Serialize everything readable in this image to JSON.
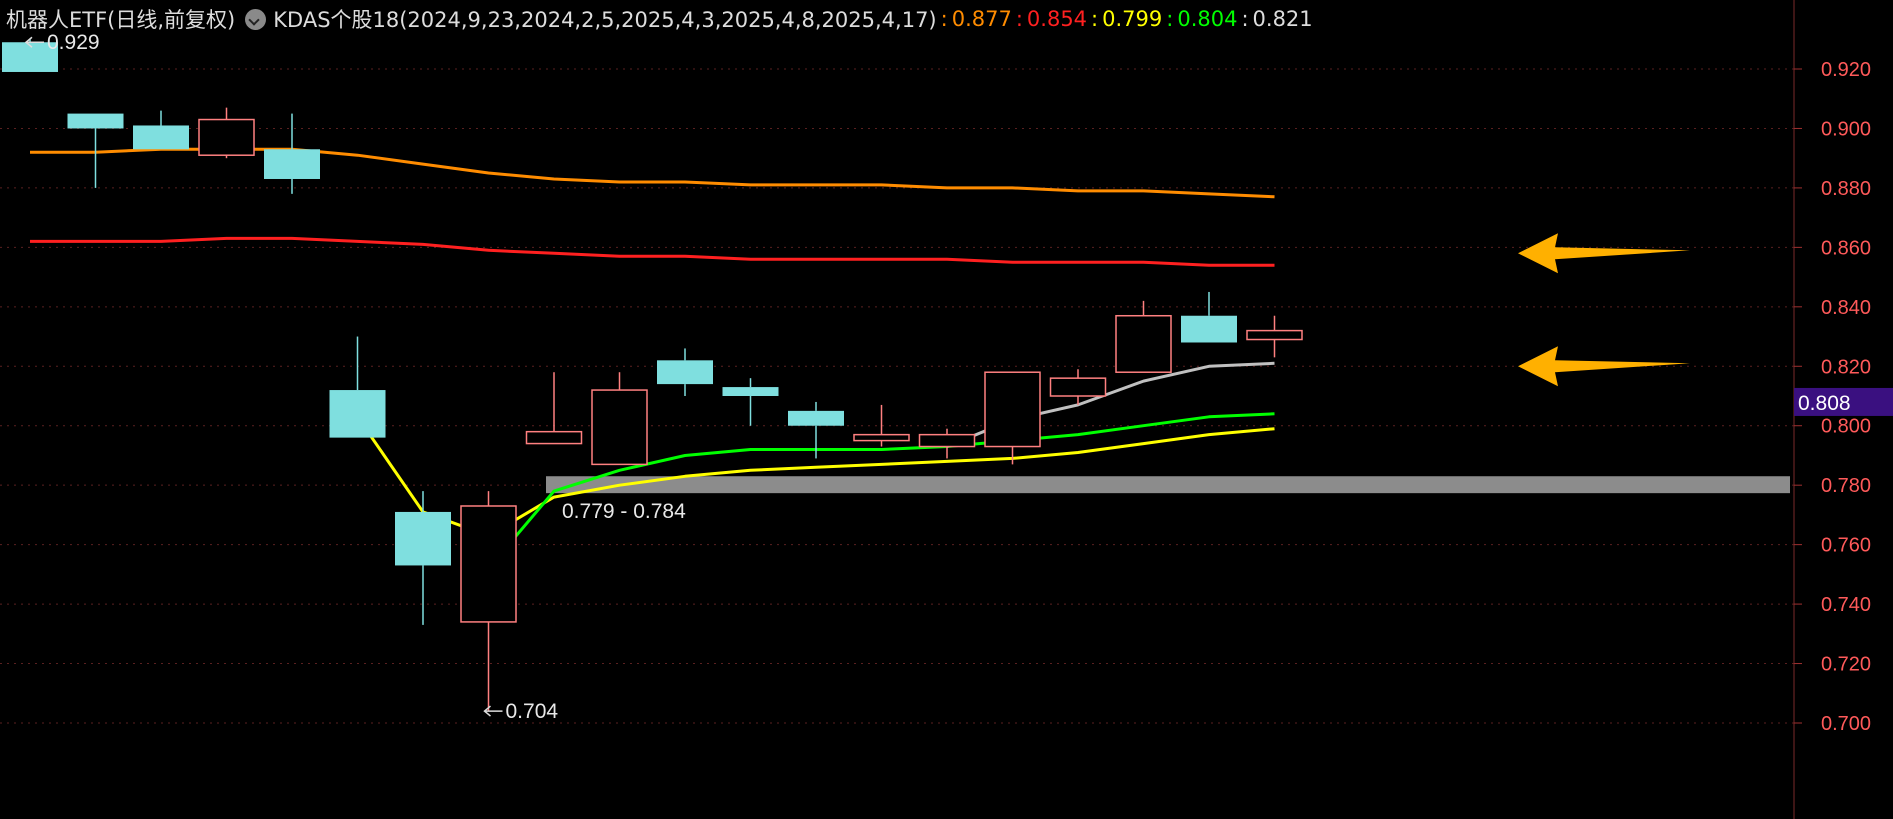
{
  "header": {
    "instrument": "机器人ETF(日线,前复权)",
    "indicator": "KDAS个股18(2024,9,23,2024,2,5,2025,4,3,2025,4,8,2025,4,17)",
    "values": [
      {
        "text": "0.877",
        "color": "#ff8c00"
      },
      {
        "text": "0.854",
        "color": "#ff2020"
      },
      {
        "text": "0.799",
        "color": "#ffff00"
      },
      {
        "text": "0.804",
        "color": "#00ff00"
      },
      {
        "text": "0.821",
        "color": "#dddddd"
      }
    ]
  },
  "colors": {
    "background": "#000000",
    "up_candle": "#ff8080",
    "down_candle": "#7fdfdf",
    "grid": "#5a2020",
    "axis_text": "#ff5a5a",
    "price_tag_bg": "#3a1080",
    "support_bar": "#8c8c8c",
    "arrow": "#ffb000"
  },
  "chart_data": {
    "type": "candlestick",
    "ylim": [
      0.695,
      0.935
    ],
    "y_ticks": [
      "0.920",
      "0.900",
      "0.880",
      "0.860",
      "0.840",
      "0.820",
      "0.800",
      "0.780",
      "0.760",
      "0.740",
      "0.720",
      "0.700"
    ],
    "candles": [
      {
        "open": 0.929,
        "high": 0.93,
        "low": 0.919,
        "close": 0.919
      },
      {
        "open": 0.905,
        "high": 0.905,
        "low": 0.88,
        "close": 0.9
      },
      {
        "open": 0.901,
        "high": 0.906,
        "low": 0.893,
        "close": 0.893
      },
      {
        "open": 0.891,
        "high": 0.907,
        "low": 0.89,
        "close": 0.903
      },
      {
        "open": 0.893,
        "high": 0.905,
        "low": 0.878,
        "close": 0.883
      },
      {
        "open": 0.812,
        "high": 0.83,
        "low": 0.796,
        "close": 0.796
      },
      {
        "open": 0.771,
        "high": 0.778,
        "low": 0.733,
        "close": 0.753
      },
      {
        "open": 0.734,
        "high": 0.778,
        "low": 0.704,
        "close": 0.773
      },
      {
        "open": 0.794,
        "high": 0.818,
        "low": 0.794,
        "close": 0.798
      },
      {
        "open": 0.787,
        "high": 0.818,
        "low": 0.787,
        "close": 0.812
      },
      {
        "open": 0.822,
        "high": 0.826,
        "low": 0.81,
        "close": 0.814
      },
      {
        "open": 0.813,
        "high": 0.816,
        "low": 0.8,
        "close": 0.81
      },
      {
        "open": 0.805,
        "high": 0.808,
        "low": 0.789,
        "close": 0.8
      },
      {
        "open": 0.795,
        "high": 0.807,
        "low": 0.793,
        "close": 0.797
      },
      {
        "open": 0.793,
        "high": 0.799,
        "low": 0.789,
        "close": 0.797
      },
      {
        "open": 0.793,
        "high": 0.818,
        "low": 0.787,
        "close": 0.818
      },
      {
        "open": 0.81,
        "high": 0.819,
        "low": 0.807,
        "close": 0.816
      },
      {
        "open": 0.818,
        "high": 0.842,
        "low": 0.818,
        "close": 0.837
      },
      {
        "open": 0.837,
        "high": 0.845,
        "low": 0.828,
        "close": 0.828
      },
      {
        "open": 0.829,
        "high": 0.837,
        "low": 0.823,
        "close": 0.832
      }
    ],
    "series": [
      {
        "color": "#ff8c00",
        "start_index": 0,
        "values": [
          0.892,
          0.892,
          0.893,
          0.893,
          0.893,
          0.891,
          0.888,
          0.885,
          0.883,
          0.882,
          0.882,
          0.881,
          0.881,
          0.881,
          0.88,
          0.88,
          0.879,
          0.879,
          0.878,
          0.877
        ]
      },
      {
        "color": "#ff2020",
        "start_index": 0,
        "values": [
          0.862,
          0.862,
          0.862,
          0.863,
          0.863,
          0.862,
          0.861,
          0.859,
          0.858,
          0.857,
          0.857,
          0.856,
          0.856,
          0.856,
          0.856,
          0.855,
          0.855,
          0.855,
          0.854,
          0.854
        ]
      },
      {
        "color": "#ffff00",
        "start_index": 5,
        "values": [
          0.803,
          0.771,
          0.763,
          0.776,
          0.78,
          0.783,
          0.785,
          0.786,
          0.787,
          0.788,
          0.789,
          0.791,
          0.794,
          0.797,
          0.799
        ]
      },
      {
        "color": "#00ff00",
        "start_index": 7,
        "values": [
          0.752,
          0.778,
          0.785,
          0.79,
          0.792,
          0.792,
          0.792,
          0.793,
          0.795,
          0.797,
          0.8,
          0.803,
          0.804
        ]
      },
      {
        "color": "#c0c0c0",
        "start_index": 14,
        "values": [
          0.793,
          0.802,
          0.807,
          0.815,
          0.82,
          0.821
        ]
      }
    ],
    "support_zone": {
      "low": 0.779,
      "high": 0.782,
      "start_index": 8,
      "label": "0.779 - 0.784"
    },
    "annotations": [
      {
        "text": "0.929",
        "index": 0,
        "value": 0.929
      },
      {
        "text": "0.704",
        "index": 7,
        "value": 0.704
      }
    ],
    "arrows": [
      {
        "value": 0.858
      },
      {
        "value": 0.82
      }
    ],
    "current_price": "0.808"
  }
}
